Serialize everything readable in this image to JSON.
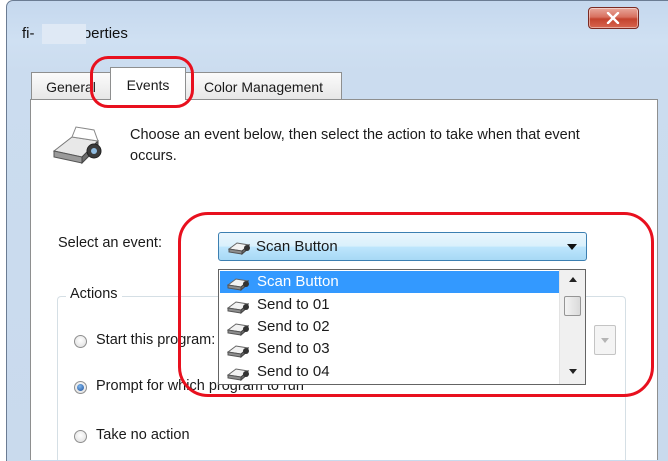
{
  "window": {
    "title": "fi-      Properties",
    "close_glyph": "X"
  },
  "tabs": [
    {
      "label": "General"
    },
    {
      "label": "Events",
      "selected": true
    },
    {
      "label": "Color Management"
    }
  ],
  "description": "Choose an event below, then select the action to take when that event occurs.",
  "event_selector": {
    "label": "Select an event:",
    "value": "Scan Button",
    "options": [
      "Scan Button",
      "Send to 01",
      "Send to 02",
      "Send to 03",
      "Send to 04"
    ],
    "selected_index": 0
  },
  "actions": {
    "legend": "Actions",
    "options": [
      {
        "label": "Start this program:",
        "selected": false
      },
      {
        "label": "Prompt for which program to run",
        "selected": true
      },
      {
        "label": "Take no action",
        "selected": false
      }
    ]
  },
  "icons": {
    "scanner": "scanner-icon",
    "small_scanner": "small-scanner-icon"
  },
  "colors": {
    "highlight": "#e8101e",
    "selection": "#3399ff",
    "title_bar": "#c5d8ee",
    "close_button": "#c4432e"
  }
}
